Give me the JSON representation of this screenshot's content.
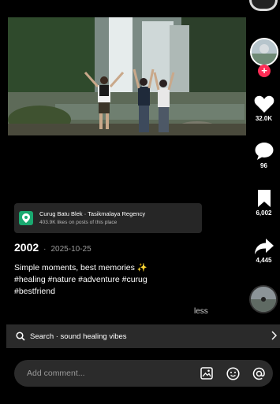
{
  "video": {
    "scene": "waterfall-photo"
  },
  "rail": {
    "avatar_icon": "creator-avatar",
    "follow_icon": "plus-icon",
    "likes": "32.0K",
    "comments": "96",
    "saves": "6,002",
    "shares": "4,445"
  },
  "location": {
    "title": "Curug Batu Blek · Tasikmalaya Regency",
    "subtitle": "403.9K likes on posts of this place"
  },
  "post": {
    "author": "2002",
    "separator": "·",
    "date": "2025-10-25",
    "caption": "Simple moments, best memories ✨\n#healing #nature #adventure #curug\n#bestfriend",
    "less": "less"
  },
  "search": {
    "label": "Search · sound healing vibes"
  },
  "comment": {
    "placeholder": "Add comment..."
  },
  "colors": {
    "accent": "#fe2c55",
    "location_icon_bg": "#1aa970",
    "bar_bg": "#2a2a2a"
  }
}
